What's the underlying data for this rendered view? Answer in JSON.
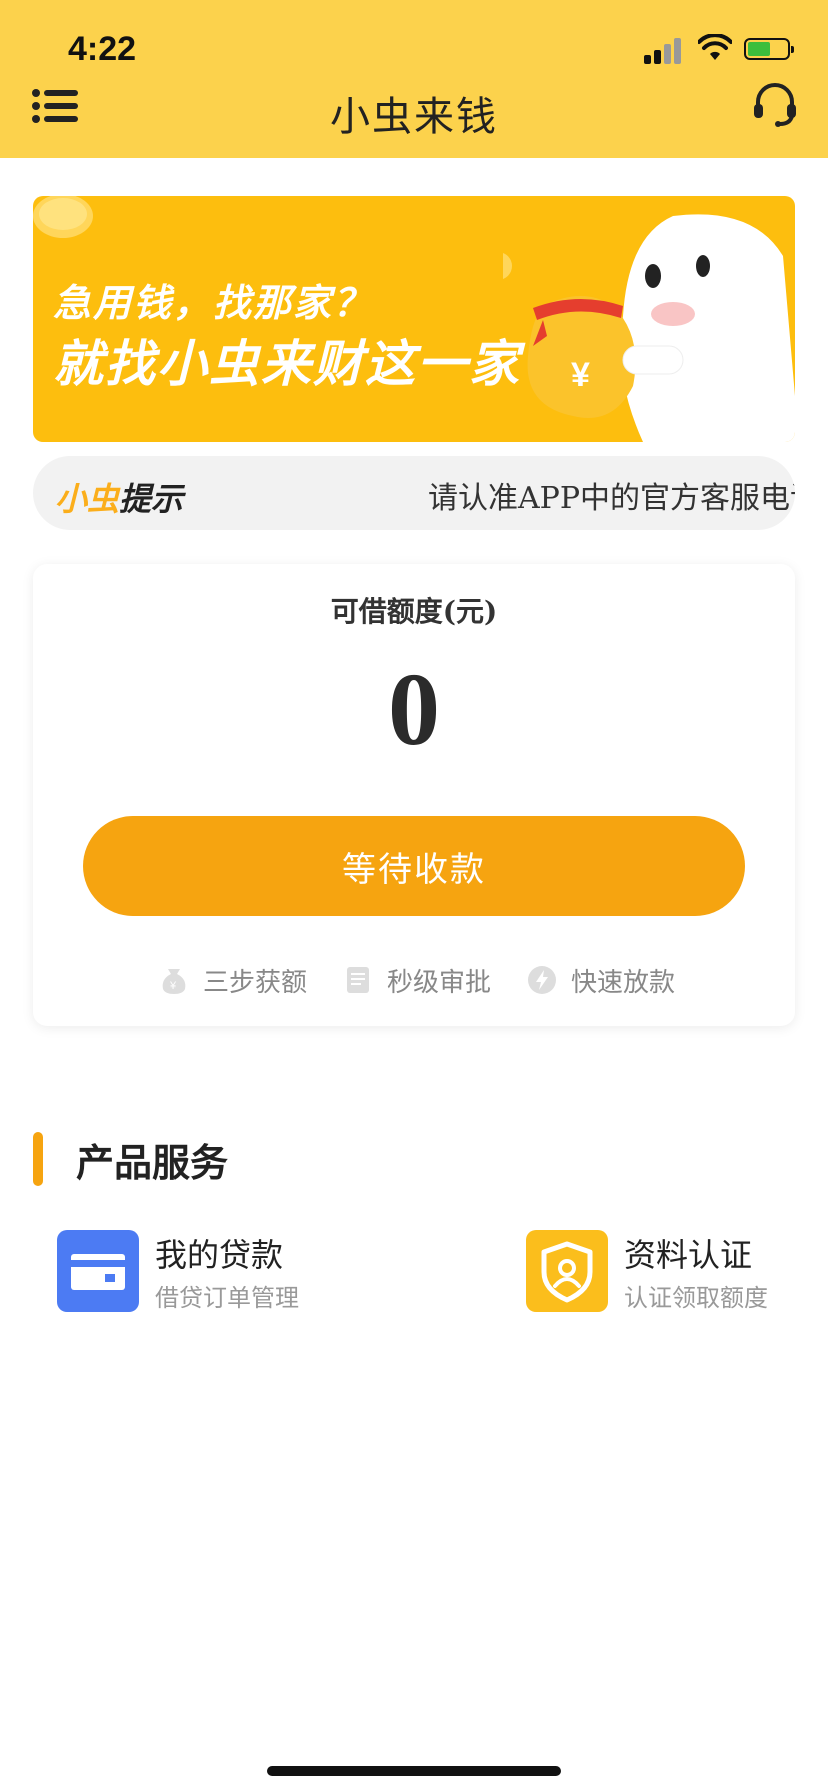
{
  "status_bar": {
    "time": "4:22"
  },
  "header": {
    "title": "小虫来钱",
    "brand_color": "#FCD24C"
  },
  "banner": {
    "line1": "急用钱，找那家？",
    "line2": "就找小虫来财这一家",
    "bg_color": "#FDBE0E"
  },
  "notice": {
    "label_part1": "小虫",
    "label_part2": "提示",
    "text": "请认准APP中的官方客服电话"
  },
  "credit_card": {
    "label": "可借额度(元)",
    "amount": "0",
    "button_label": "等待收款",
    "accent_color": "#F6A410",
    "features": [
      {
        "icon": "money-bag-icon",
        "label": "三步获额"
      },
      {
        "icon": "document-icon",
        "label": "秒级审批"
      },
      {
        "icon": "lightning-icon",
        "label": "快速放款"
      }
    ]
  },
  "products": {
    "section_title": "产品服务",
    "items": [
      {
        "icon": "credit-card-icon",
        "name": "我的贷款",
        "subtitle": "借贷订单管理",
        "color": "#4C7BF3"
      },
      {
        "icon": "shield-user-icon",
        "name": "资料认证",
        "subtitle": "认证领取额度",
        "color": "#FBBE1C"
      }
    ]
  }
}
